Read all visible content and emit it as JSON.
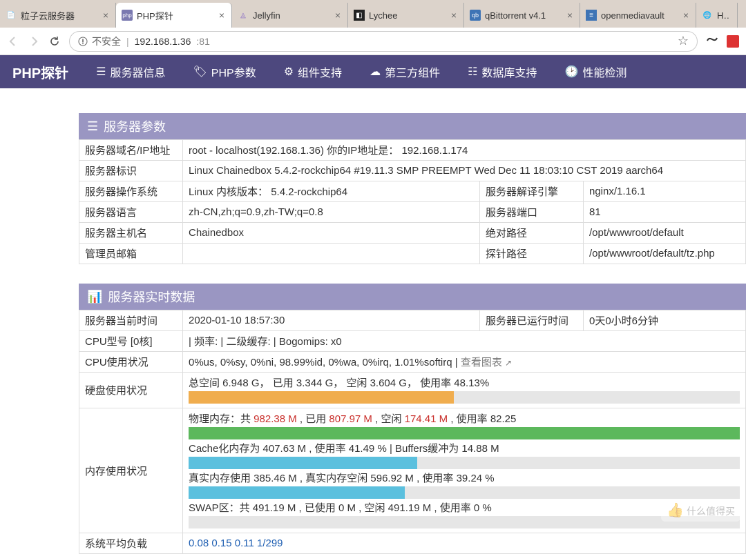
{
  "tabs": [
    {
      "label": "粒子云服务器",
      "icon": "📄"
    },
    {
      "label": "PHP探针",
      "icon": "php",
      "active": true
    },
    {
      "label": "Jellyfin",
      "icon": "◬"
    },
    {
      "label": "Lychee",
      "icon": "◧"
    },
    {
      "label": "qBittorrent v4.1",
      "icon": "qb"
    },
    {
      "label": "openmediavault",
      "icon": "≡"
    },
    {
      "label": "Hell",
      "icon": "🌐"
    }
  ],
  "url": {
    "insecure": "不安全",
    "address": "192.168.1.36",
    "port": ":81"
  },
  "brand": "PHP探针",
  "menu": [
    "服务器信息",
    "PHP参数",
    "组件支持",
    "第三方组件",
    "数据库支持",
    "性能检测"
  ],
  "section1_title": "服务器参数",
  "s1": {
    "r1": {
      "k": "服务器域名/IP地址",
      "v": "root - localhost(192.168.1.36)  你的IP地址是： 192.168.1.174"
    },
    "r2": {
      "k": "服务器标识",
      "v": "Linux Chainedbox 5.4.2-rockchip64 #19.11.3 SMP PREEMPT Wed Dec 11 18:03:10 CST 2019 aarch64"
    },
    "r3": {
      "k": "服务器操作系统",
      "v": "Linux  内核版本： 5.4.2-rockchip64",
      "k2": "服务器解译引擎",
      "v2": "nginx/1.16.1"
    },
    "r4": {
      "k": "服务器语言",
      "v": "zh-CN,zh;q=0.9,zh-TW;q=0.8",
      "k2": "服务器端口",
      "v2": "81"
    },
    "r5": {
      "k": "服务器主机名",
      "v": "Chainedbox",
      "k2": "绝对路径",
      "v2": "/opt/wwwroot/default"
    },
    "r6": {
      "k": "管理员邮箱",
      "v": "",
      "k2": "探针路径",
      "v2": "/opt/wwwroot/default/tz.php"
    }
  },
  "section2_title": "服务器实时数据",
  "s2": {
    "time": {
      "k": "服务器当前时间",
      "v": "2020-01-10 18:57:30",
      "k2": "服务器已运行时间",
      "v2": "0天0小时6分钟"
    },
    "cpu": {
      "k": "CPU型号 [0核]",
      "v": "| 频率: | 二级缓存: | Bogomips: x0"
    },
    "cpuuse": {
      "k": "CPU使用状况",
      "v": "0%us, 0%sy, 0%ni, 98.99%id, 0%wa, 0%irq, 1.01%softirq | ",
      "link": "查看图表 "
    },
    "disk": {
      "k": "硬盘使用状况",
      "line": "总空间 6.948 G， 已用 3.344 G， 空闲 3.604 G， 使用率 48.13%",
      "pct": 48.13
    },
    "mem": {
      "k": "内存使用状况",
      "l1a": "物理内存：共 ",
      "l1b": "982.38 M",
      "l1c": " , 已用 ",
      "l1d": "807.97 M",
      "l1e": " , 空闲 ",
      "l1f": "174.41 M",
      "l1g": " , 使用率 82.25",
      "p1": 100,
      "l2": "Cache化内存为 407.63 M , 使用率 41.49 % | Buffers缓冲为 14.88 M",
      "p2": 41.49,
      "l3": "真实内存使用 385.46 M , 真实内存空闲 596.92 M , 使用率 39.24 %",
      "p3": 39.24,
      "l4": "SWAP区：共 491.19 M , 已使用 0 M , 空闲 491.19 M , 使用率 0 %",
      "p4": 0
    },
    "load": {
      "k": "系统平均负载",
      "v": "0.08 0.15 0.11 1/299"
    }
  },
  "watermark": "什么值得买"
}
